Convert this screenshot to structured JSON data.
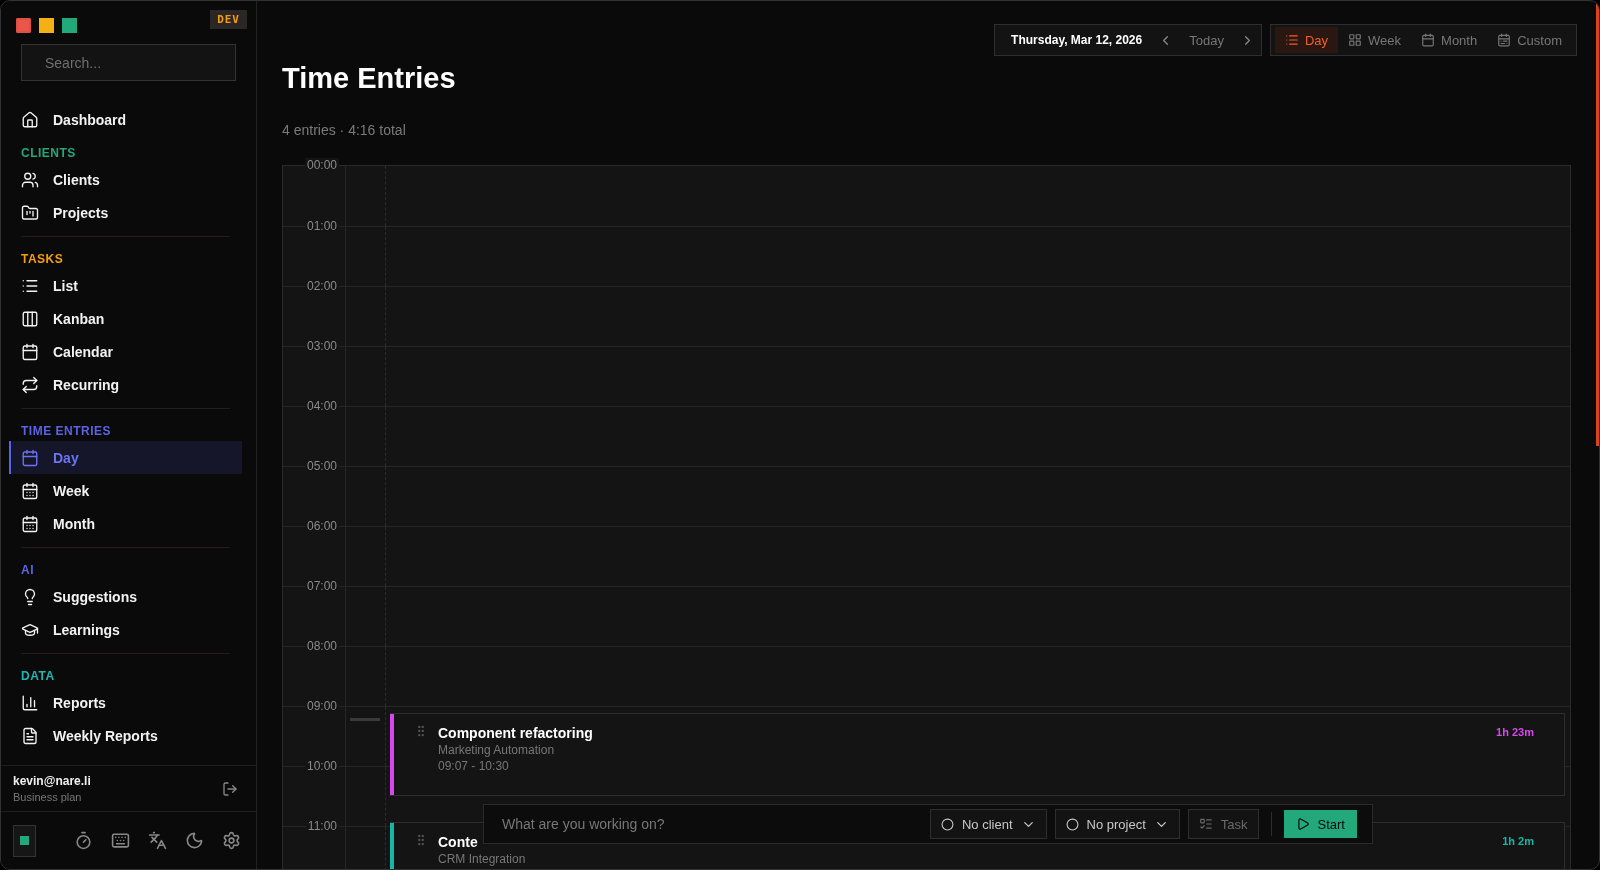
{
  "badge": "DEV",
  "search": {
    "placeholder": "Search..."
  },
  "nav": [
    {
      "label": "Dashboard",
      "selected": false
    }
  ],
  "sections": [
    {
      "title": "CLIENTS",
      "color": "#22a87a",
      "items": [
        {
          "label": "Clients",
          "selected": false
        },
        {
          "label": "Projects",
          "selected": false
        }
      ]
    },
    {
      "title": "TASKS",
      "color": "#f59e0b",
      "items": [
        {
          "label": "List",
          "selected": false
        },
        {
          "label": "Kanban",
          "selected": false
        },
        {
          "label": "Calendar",
          "selected": false
        },
        {
          "label": "Recurring",
          "selected": false
        }
      ]
    },
    {
      "title": "TIME ENTRIES",
      "color": "#5b63e6",
      "items": [
        {
          "label": "Day",
          "selected": true
        },
        {
          "label": "Week",
          "selected": false
        },
        {
          "label": "Month",
          "selected": false
        }
      ]
    },
    {
      "title": "AI",
      "color": "#5b63e6",
      "items": [
        {
          "label": "Suggestions",
          "selected": false
        },
        {
          "label": "Learnings",
          "selected": false
        }
      ]
    },
    {
      "title": "DATA",
      "color": "#1fb5b5",
      "items": [
        {
          "label": "Reports",
          "selected": false
        },
        {
          "label": "Weekly Reports",
          "selected": false
        }
      ]
    }
  ],
  "account": {
    "email": "kevin@nare.li",
    "plan": "Business plan"
  },
  "toolbar": {
    "date": "Thursday, Mar 12, 2026",
    "today": "Today",
    "views": [
      {
        "label": "Day",
        "selected": true
      },
      {
        "label": "Week",
        "selected": false
      },
      {
        "label": "Month",
        "selected": false
      },
      {
        "label": "Custom",
        "selected": false
      }
    ]
  },
  "page": {
    "title": "Time Entries",
    "summary": "4 entries · 4:16 total"
  },
  "timeline": {
    "hours": [
      "00:00",
      "01:00",
      "02:00",
      "03:00",
      "04:00",
      "05:00",
      "06:00",
      "07:00",
      "08:00",
      "09:00",
      "10:00",
      "11:00"
    ],
    "entries": [
      {
        "title": "Component refactoring",
        "project": "Marketing Automation",
        "time": "09:07 - 10:30",
        "duration": "1h 23m",
        "color": "#d946ef"
      },
      {
        "title": "Conte",
        "project": "CRM Integration",
        "duration": "1h 2m",
        "color": "#14b8a6"
      }
    ]
  },
  "timer_bar": {
    "placeholder": "What are you working on?",
    "client": "No client",
    "project": "No project",
    "task": "Task",
    "start": "Start"
  }
}
